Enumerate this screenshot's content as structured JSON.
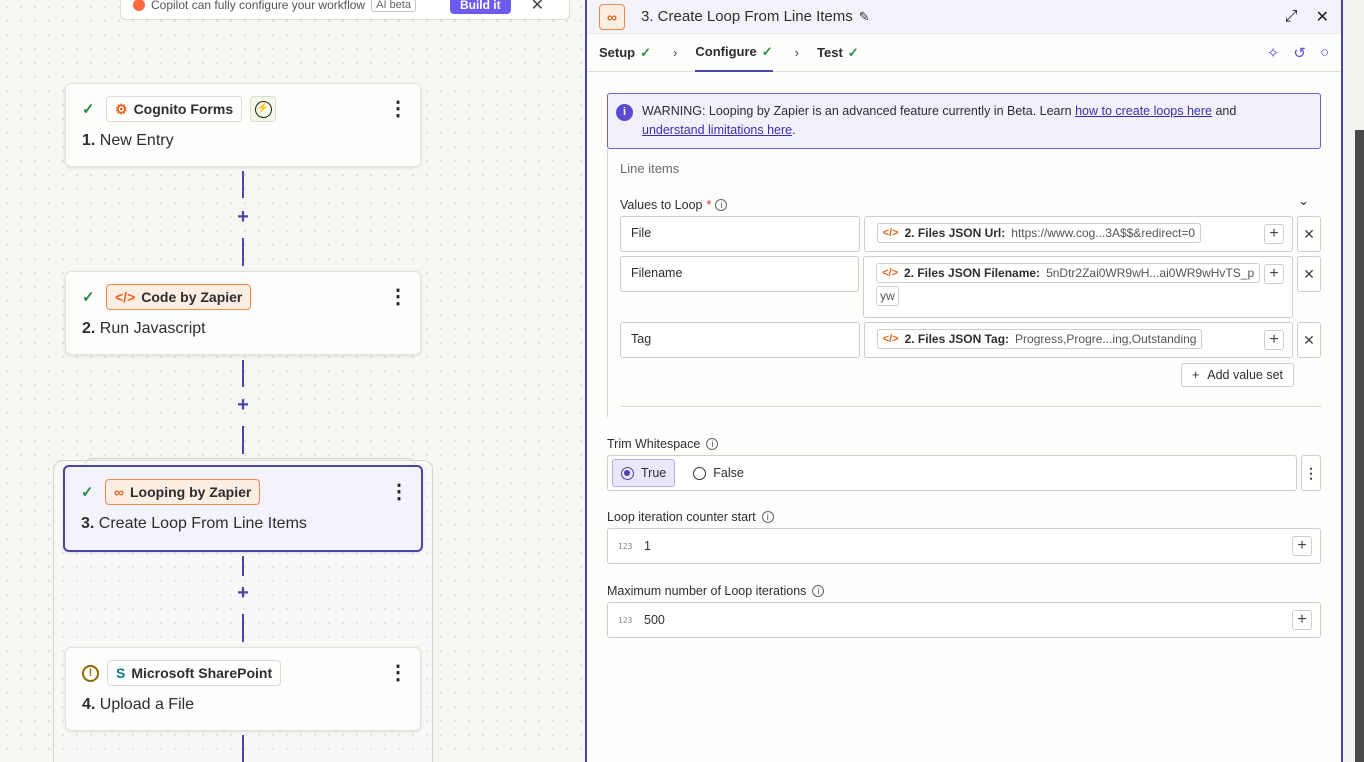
{
  "copilot": {
    "text": "Copilot can fully configure your workflow",
    "badge": "AI beta",
    "build_label": "Build it"
  },
  "steps": [
    {
      "number": "1.",
      "title": "New Entry",
      "app": "Cognito Forms",
      "status": "complete",
      "icon": "cognito-gear-icon"
    },
    {
      "number": "2.",
      "title": "Run Javascript",
      "app": "Code by Zapier",
      "status": "complete",
      "icon": "code-icon"
    },
    {
      "number": "3.",
      "title": "Create Loop From Line Items",
      "app": "Looping by Zapier",
      "status": "complete",
      "icon": "loop-icon"
    },
    {
      "number": "4.",
      "title": "Upload a File",
      "app": "Microsoft SharePoint",
      "status": "warning",
      "icon": "sharepoint-icon"
    }
  ],
  "panel": {
    "title": "3. Create Loop From Line Items",
    "tabs": [
      {
        "label": "Setup",
        "done": true
      },
      {
        "label": "Configure",
        "done": true,
        "active": true
      },
      {
        "label": "Test",
        "done": true
      }
    ],
    "warning": {
      "prefix": "WARNING: Looping by Zapier is an advanced feature currently in Beta. Learn ",
      "link1": "how to create loops here",
      "middle": " and",
      "link2": "understand limitations here",
      "suffix": "."
    },
    "line_items": {
      "heading": "Line items",
      "values_label": "Values to Loop",
      "rows": [
        {
          "key": "File",
          "token_label": "2. Files JSON Url:",
          "token_value": "https://www.cog...3A$$&redirect=0",
          "token_cont": ""
        },
        {
          "key": "Filename",
          "token_label": "2. Files JSON Filename:",
          "token_value": "5nDtr2Zai0WR9wH...ai0WR9wHvTS_p",
          "token_cont": "yw"
        },
        {
          "key": "Tag",
          "token_label": "2. Files JSON Tag:",
          "token_value": "Progress,Progre...ing,Outstanding",
          "token_cont": ""
        }
      ],
      "add_set_label": "Add value set"
    },
    "trim": {
      "label": "Trim Whitespace",
      "options": [
        "True",
        "False"
      ],
      "selected": "True"
    },
    "counter_start": {
      "label": "Loop iteration counter start",
      "value": "1"
    },
    "max_iterations": {
      "label": "Maximum number of Loop iterations",
      "value": "500"
    }
  },
  "colors": {
    "accent": "#4c45a8",
    "check": "#2c8a43",
    "orange": "#e8631a"
  }
}
